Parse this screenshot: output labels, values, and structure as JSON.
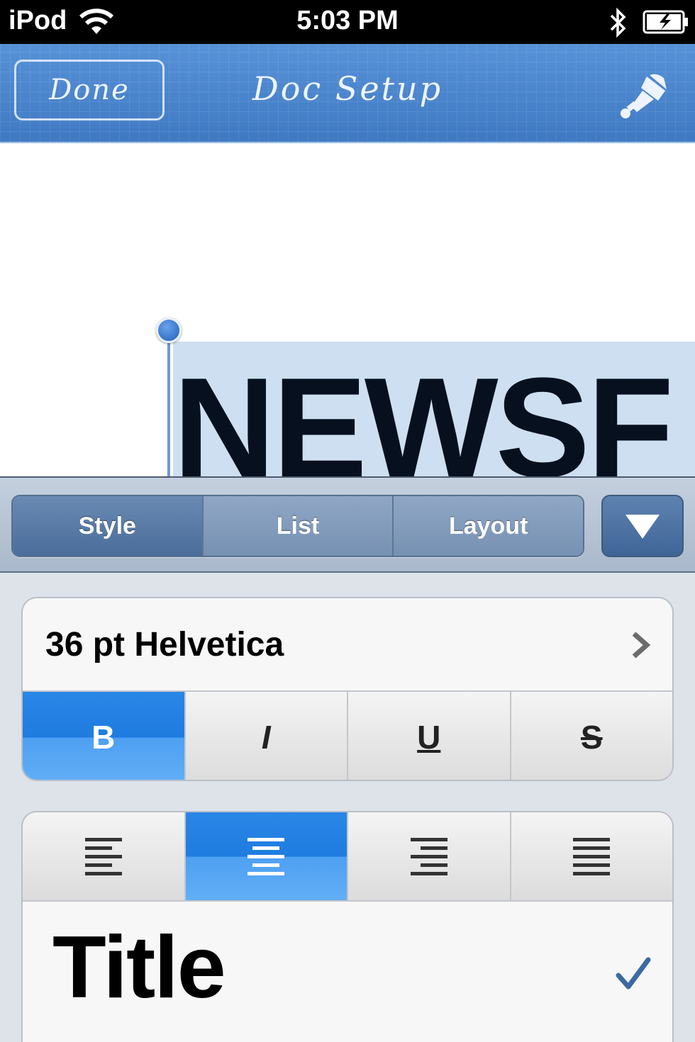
{
  "status": {
    "carrier": "iPod",
    "time": "5:03 PM"
  },
  "nav": {
    "done_label": "Done",
    "title": "Doc Setup"
  },
  "document": {
    "visible_text": "NEWSF"
  },
  "tabs": [
    {
      "label": "Style",
      "active": true
    },
    {
      "label": "List",
      "active": false
    },
    {
      "label": "Layout",
      "active": false
    }
  ],
  "font": {
    "label": "36 pt Helvetica"
  },
  "format_buttons": [
    {
      "label": "B",
      "active": true
    },
    {
      "label": "I",
      "active": false
    },
    {
      "label": "U",
      "active": false
    },
    {
      "label": "S",
      "active": false
    }
  ],
  "alignment": {
    "selected": "center",
    "options": [
      "left",
      "center",
      "right",
      "justify"
    ]
  },
  "paragraph_style": {
    "label": "Title",
    "selected": true
  },
  "colors": {
    "nav_blue": "#4a86cf",
    "active_blue": "#1f7ce0",
    "check_blue": "#3b6aa3"
  },
  "icons": [
    "wifi-icon",
    "bluetooth-icon",
    "battery-icon",
    "paint-brush-icon",
    "triangle-down-icon",
    "chevron-right-icon",
    "align-left-icon",
    "align-center-icon",
    "align-right-icon",
    "align-justify-icon",
    "checkmark-icon"
  ]
}
